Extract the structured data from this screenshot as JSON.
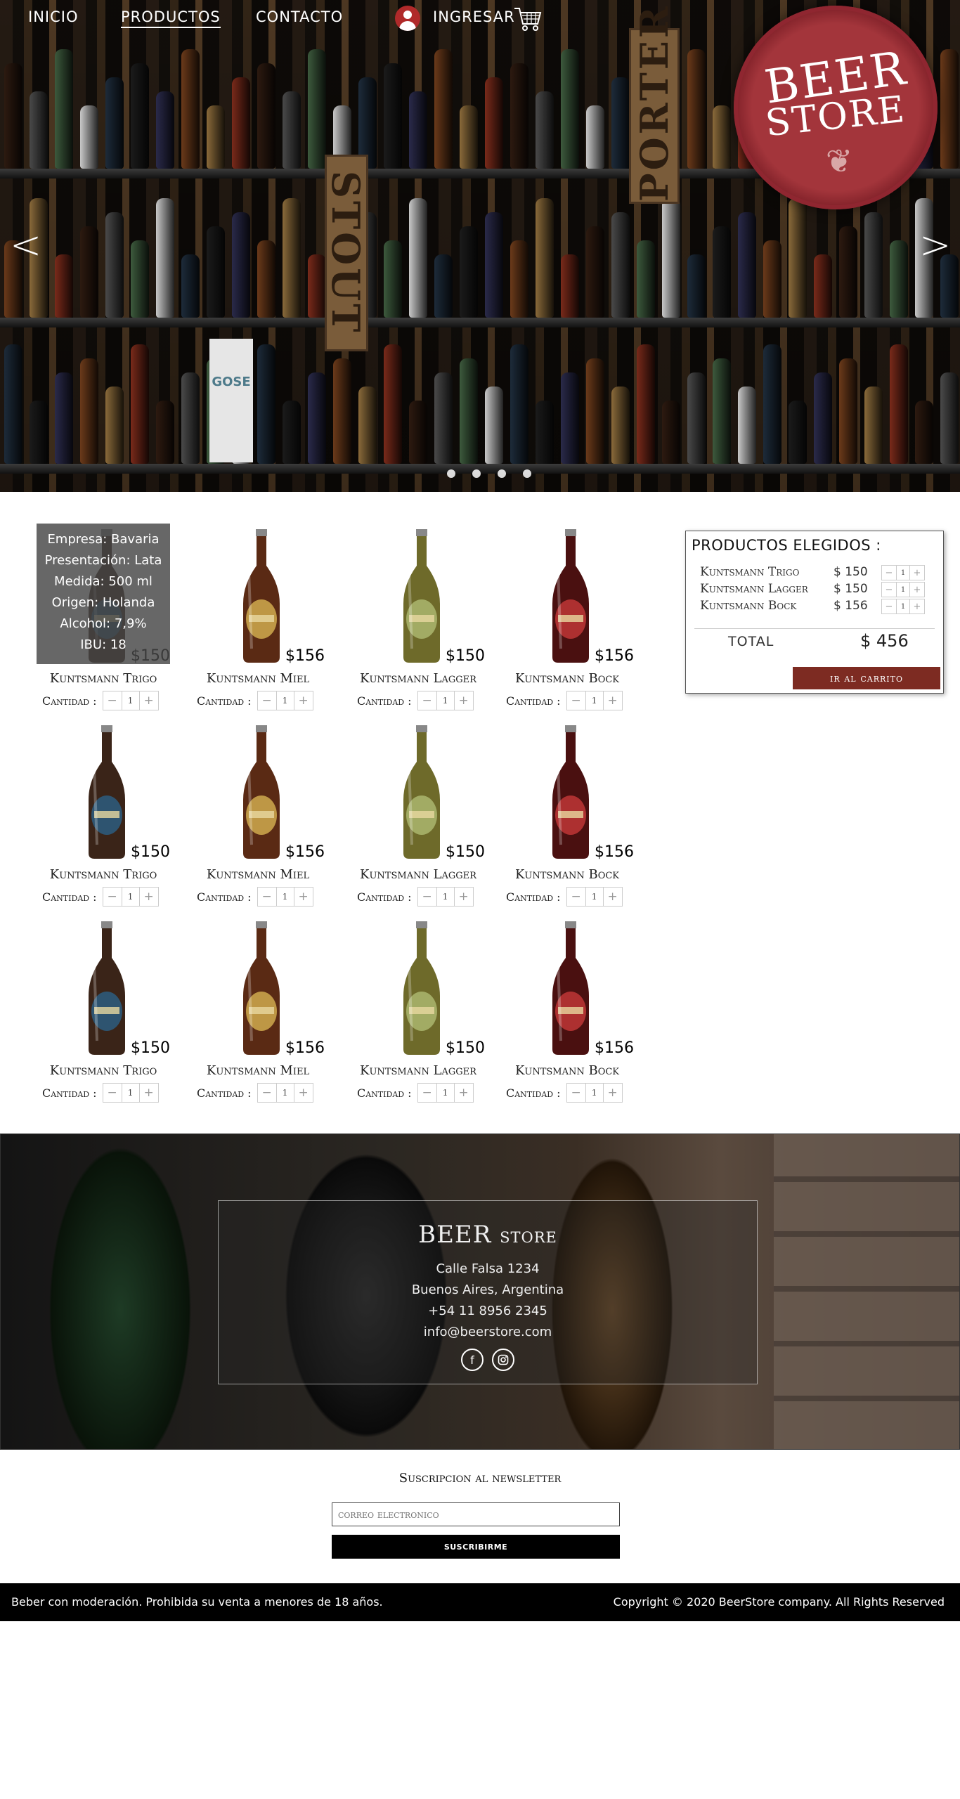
{
  "nav": {
    "inicio": "INICIO",
    "productos": "PRODUCTOS",
    "contacto": "CONTACTO",
    "ingresar": "INGRESAR",
    "user_icon": "user-avatar-icon",
    "cart_icon": "shopping-cart-icon"
  },
  "hero": {
    "logo_line1": "BEER",
    "logo_line2": "STORE",
    "sign_porter": "PORTER",
    "sign_stout": "STOUT",
    "gose": "GOSE",
    "prev_glyph": "<",
    "next_glyph": ">",
    "slide_count": 4
  },
  "overlay": {
    "empresa": "Empresa: Bavaria",
    "presentacion": "Presentación: Lata",
    "medida": "Medida: 500 ml",
    "origen": "Origen: Holanda",
    "alcohol": "Alcohol: 7,9%",
    "ibu": "IBU: 18"
  },
  "products": [
    {
      "name": "Kuntsmann Trigo",
      "price": "$150",
      "qty": "1",
      "qty_label": "Cantidad :",
      "color": "#3a2418",
      "label_color": "#2d5a7a"
    },
    {
      "name": "Kuntsmann Miel",
      "price": "$156",
      "qty": "1",
      "qty_label": "Cantidad :",
      "color": "#5a2a14",
      "label_color": "#c9a34a"
    },
    {
      "name": "Kuntsmann Lagger",
      "price": "$150",
      "qty": "1",
      "qty_label": "Cantidad :",
      "color": "#6e6a2a",
      "label_color": "#a7b26a"
    },
    {
      "name": "Kuntsmann Bock",
      "price": "$156",
      "qty": "1",
      "qty_label": "Cantidad :",
      "color": "#4a1010",
      "label_color": "#b83434"
    },
    {
      "name": "Kuntsmann Trigo",
      "price": "$150",
      "qty": "1",
      "qty_label": "Cantidad :",
      "color": "#3a2418",
      "label_color": "#2d5a7a"
    },
    {
      "name": "Kuntsmann Miel",
      "price": "$156",
      "qty": "1",
      "qty_label": "Cantidad :",
      "color": "#5a2a14",
      "label_color": "#c9a34a"
    },
    {
      "name": "Kuntsmann Lagger",
      "price": "$150",
      "qty": "1",
      "qty_label": "Cantidad :",
      "color": "#6e6a2a",
      "label_color": "#a7b26a"
    },
    {
      "name": "Kuntsmann Bock",
      "price": "$156",
      "qty": "1",
      "qty_label": "Cantidad :",
      "color": "#4a1010",
      "label_color": "#b83434"
    },
    {
      "name": "Kuntsmann Trigo",
      "price": "$150",
      "qty": "1",
      "qty_label": "Cantidad :",
      "color": "#3a2418",
      "label_color": "#2d5a7a"
    },
    {
      "name": "Kuntsmann Miel",
      "price": "$156",
      "qty": "1",
      "qty_label": "Cantidad :",
      "color": "#5a2a14",
      "label_color": "#c9a34a"
    },
    {
      "name": "Kuntsmann Lagger",
      "price": "$150",
      "qty": "1",
      "qty_label": "Cantidad :",
      "color": "#6e6a2a",
      "label_color": "#a7b26a"
    },
    {
      "name": "Kuntsmann Bock",
      "price": "$156",
      "qty": "1",
      "qty_label": "Cantidad :",
      "color": "#4a1010",
      "label_color": "#b83434"
    }
  ],
  "cart": {
    "title": "PRODUCTOS ELEGIDOS :",
    "items": [
      {
        "name": "Kuntsmann Trigo",
        "price": "$ 150",
        "qty": "1"
      },
      {
        "name": "Kuntsmann Lagger",
        "price": "$ 150",
        "qty": "1"
      },
      {
        "name": "Kuntsmann Bock",
        "price": "$ 156",
        "qty": "1"
      }
    ],
    "total_label": "TOTAL",
    "total_value": "$ 456",
    "button": "ir al carrito"
  },
  "footer": {
    "logo_beer": "BEER",
    "logo_store": "store",
    "address": "Calle Falsa 1234",
    "city": "Buenos Aires, Argentina",
    "phone": "+54 11 8956 2345",
    "email": "info@beerstore.com",
    "facebook_icon": "facebook-icon",
    "instagram_icon": "instagram-icon"
  },
  "newsletter": {
    "title": "Suscripcion al newsletter",
    "placeholder": "correo electronico",
    "button": "SUSCRIBIRME"
  },
  "bottom": {
    "left": "Beber con moderación. Prohibida su venta a menores de 18 años.",
    "right": "Copyright © 2020 BeerStore company. All Rights Reserved"
  },
  "colors": {
    "accent": "#7d2b22",
    "logo_red": "#a3353b"
  }
}
